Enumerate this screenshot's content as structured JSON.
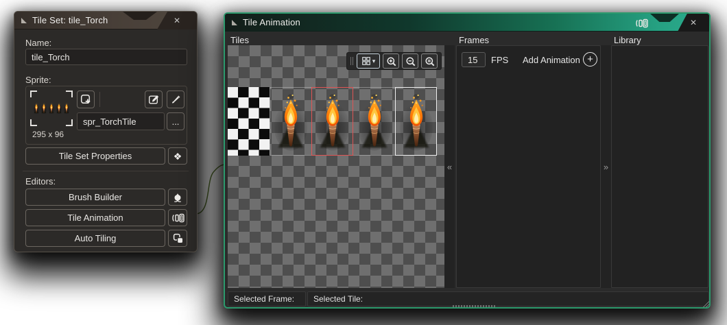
{
  "tileset": {
    "title": "Tile Set: tile_Torch",
    "name_label": "Name:",
    "name_value": "tile_Torch",
    "sprite_label": "Sprite:",
    "sprite_name": "spr_TorchTile",
    "sprite_size": "295 x 96",
    "more_button": "...",
    "properties_button": "Tile Set Properties",
    "editors_label": "Editors:",
    "editor_buttons": [
      {
        "label": "Brush Builder"
      },
      {
        "label": "Tile Animation"
      },
      {
        "label": "Auto Tiling"
      }
    ]
  },
  "anim": {
    "title": "Tile Animation",
    "tiles_title": "Tiles",
    "frames_title": "Frames",
    "library_title": "Library",
    "fps_value": "15",
    "fps_label": "FPS",
    "add_animation": "Add Animation",
    "selected_frame_label": "Selected Frame:",
    "selected_tile_label": "Selected Tile:"
  },
  "icons": {
    "close": "✕",
    "properties": "❖",
    "caret_down": "▾",
    "collapse_left": "«",
    "collapse_right": "»",
    "add_plus": "+"
  },
  "colors": {
    "accent_green": "#2aa189",
    "titlebar_brown": "#4a413a",
    "selection_red": "#e05555",
    "selection_white": "#f0f0f0",
    "checker_dark": "#4e4e4e",
    "checker_light": "#6f6f6f",
    "flame_orange": "#ff8d12",
    "flame_core": "#ffefad"
  }
}
